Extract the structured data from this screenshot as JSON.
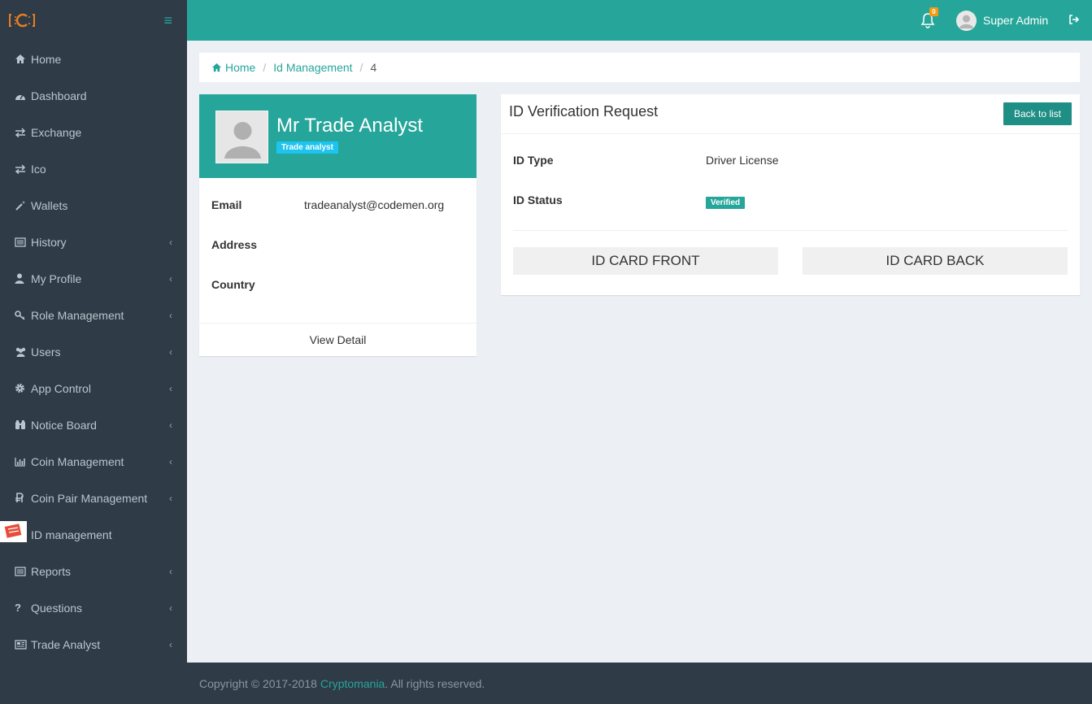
{
  "colors": {
    "accent": "#26a69a",
    "sidebar": "#2f3b47",
    "role_badge": "#1ec4f0",
    "notif_badge": "#f39c12"
  },
  "header": {
    "notification_count": "0",
    "user_name": "Super Admin"
  },
  "sidebar": {
    "items": [
      {
        "label": "Home",
        "icon": "home-icon",
        "has_children": false
      },
      {
        "label": "Dashboard",
        "icon": "dashboard-icon",
        "has_children": false
      },
      {
        "label": "Exchange",
        "icon": "exchange-icon",
        "has_children": false
      },
      {
        "label": "Ico",
        "icon": "exchange-icon",
        "has_children": false
      },
      {
        "label": "Wallets",
        "icon": "wand-icon",
        "has_children": false
      },
      {
        "label": "History",
        "icon": "list-icon",
        "has_children": true
      },
      {
        "label": "My Profile",
        "icon": "user-icon",
        "has_children": true
      },
      {
        "label": "Role Management",
        "icon": "key-icon",
        "has_children": true
      },
      {
        "label": "Users",
        "icon": "users-icon",
        "has_children": true
      },
      {
        "label": "App Control",
        "icon": "gear-icon",
        "has_children": true
      },
      {
        "label": "Notice Board",
        "icon": "binoculars-icon",
        "has_children": true
      },
      {
        "label": "Coin Management",
        "icon": "bar-chart-icon",
        "has_children": true
      },
      {
        "label": "Coin Pair Management",
        "icon": "ruble-icon",
        "has_children": true
      },
      {
        "label": "ID management",
        "icon": "id-badge-icon",
        "has_children": false
      },
      {
        "label": "Reports",
        "icon": "list-icon",
        "has_children": true
      },
      {
        "label": "Questions",
        "icon": "question-icon",
        "has_children": true
      },
      {
        "label": "Trade Analyst",
        "icon": "newspaper-icon",
        "has_children": true
      }
    ]
  },
  "breadcrumb": {
    "home": "Home",
    "section": "Id Management",
    "current": "4"
  },
  "profile": {
    "name": "Mr Trade Analyst",
    "role": "Trade analyst",
    "email_label": "Email",
    "email": "tradeanalyst@codemen.org",
    "address_label": "Address",
    "address": "",
    "country_label": "Country",
    "country": "",
    "view_detail": "View Detail"
  },
  "verification": {
    "title": "ID Verification Request",
    "back_label": "Back to list",
    "id_type_label": "ID Type",
    "id_type": "Driver License",
    "id_status_label": "ID Status",
    "id_status": "Verified",
    "front_label": "ID CARD FRONT",
    "back_card_label": "ID CARD BACK"
  },
  "footer": {
    "copyright": "Copyright © 2017-2018",
    "brand": "Cryptomania",
    "suffix": ". All rights reserved."
  }
}
